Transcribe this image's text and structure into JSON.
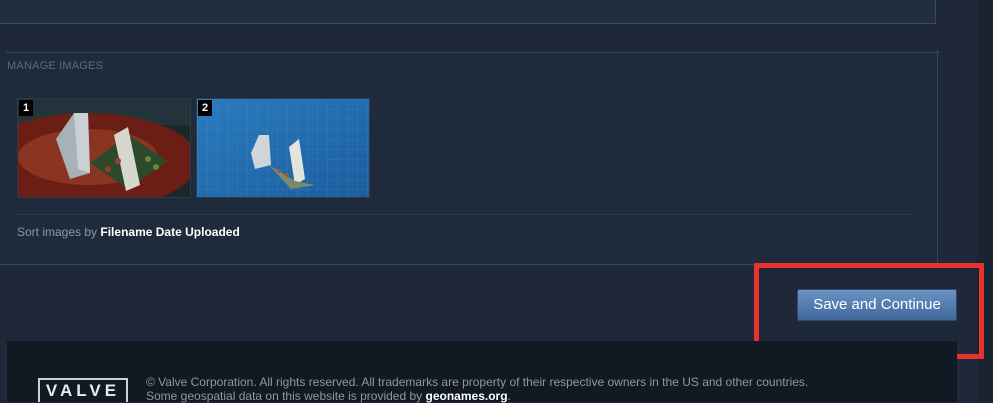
{
  "manage_images": {
    "section_title": "MANAGE IMAGES",
    "thumbnails": [
      {
        "number": "1"
      },
      {
        "number": "2"
      }
    ],
    "sort": {
      "prefix": "Sort images by",
      "options": [
        "Filename",
        "Date Uploaded"
      ]
    }
  },
  "actions": {
    "save_continue_label": "Save and Continue"
  },
  "footer": {
    "logo_text": "VALVE",
    "copyright": "© Valve Corporation. All rights reserved. All trademarks are property of their respective owners in the US and other countries.",
    "geo_prefix": "Some geospatial data on this website is provided by",
    "geo_link": "geonames.org",
    "geo_suffix": "."
  },
  "colors": {
    "background": "#1e2838",
    "button_top": "#6a93c4",
    "button_bottom": "#41679a",
    "highlight": "#e8322b"
  }
}
